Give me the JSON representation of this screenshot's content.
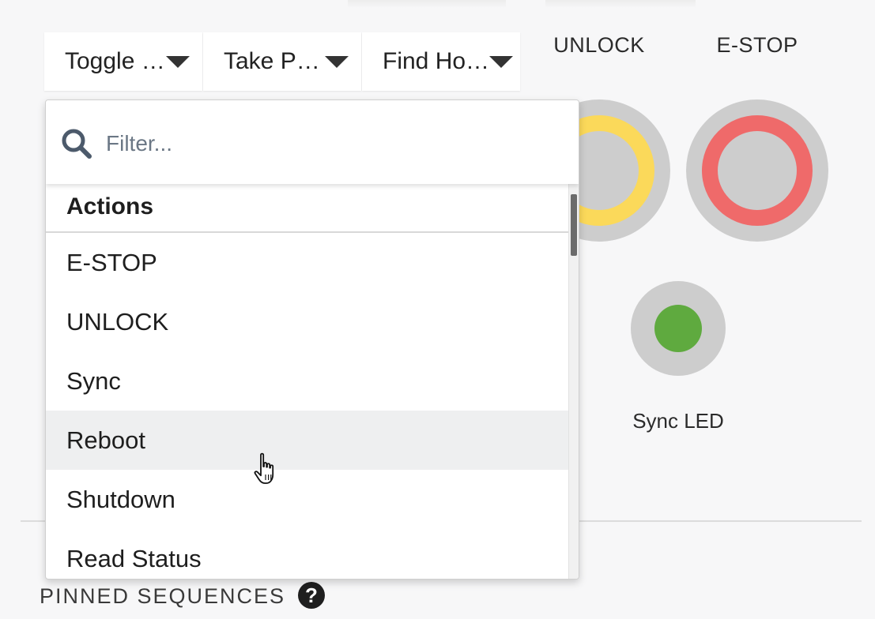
{
  "toolbar": {
    "buttons": [
      {
        "label": "Toggle …"
      },
      {
        "label": "Take P…"
      },
      {
        "label": "Find Ho…"
      }
    ]
  },
  "controls": {
    "unlock_label": "UNLOCK",
    "estop_label": "E-STOP",
    "sync_led_label": "Sync LED",
    "unlock_color": "#fbd95a",
    "estop_color": "#ef6a6a",
    "led_color": "#5faa3f"
  },
  "dropdown": {
    "filter_placeholder": "Filter...",
    "filter_value": "",
    "group_header": "Actions",
    "items": [
      "E-STOP",
      "UNLOCK",
      "Sync",
      "Reboot",
      "Shutdown",
      "Read Status"
    ],
    "hovered_item": "Reboot"
  },
  "footer": {
    "pinned_label": "PINNED SEQUENCES",
    "help_symbol": "?"
  }
}
